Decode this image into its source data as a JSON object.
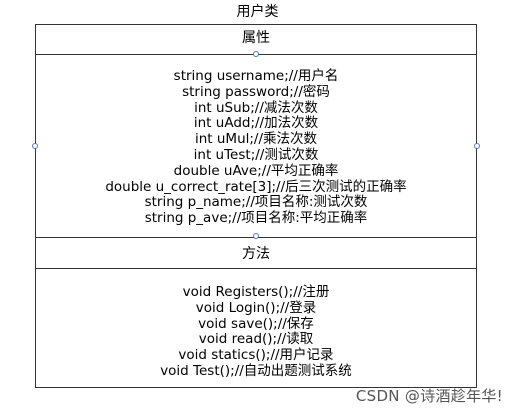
{
  "class_name": "用户类",
  "attributes_header": "属性",
  "attributes": [
    "string username;//用户名",
    "string password;//密码",
    "int uSub;//减法次数",
    "int uAdd;//加法次数",
    "int uMul;//乘法次数",
    "int uTest;//测试次数",
    "double uAve;//平均正确率",
    "double u_correct_rate[3];//后三次测试的正确率",
    "string p_name;//项目名称:测试次数",
    "string p_ave;//项目名称:平均正确率"
  ],
  "methods_header": "方法",
  "methods": [
    "void Registers();//注册",
    "void Login();//登录",
    "void save();//保存",
    "void read();//读取",
    "void statics();//用户记录",
    "void Test();//自动出题测试系统"
  ],
  "watermark": "CSDN @诗酒趁年华!"
}
